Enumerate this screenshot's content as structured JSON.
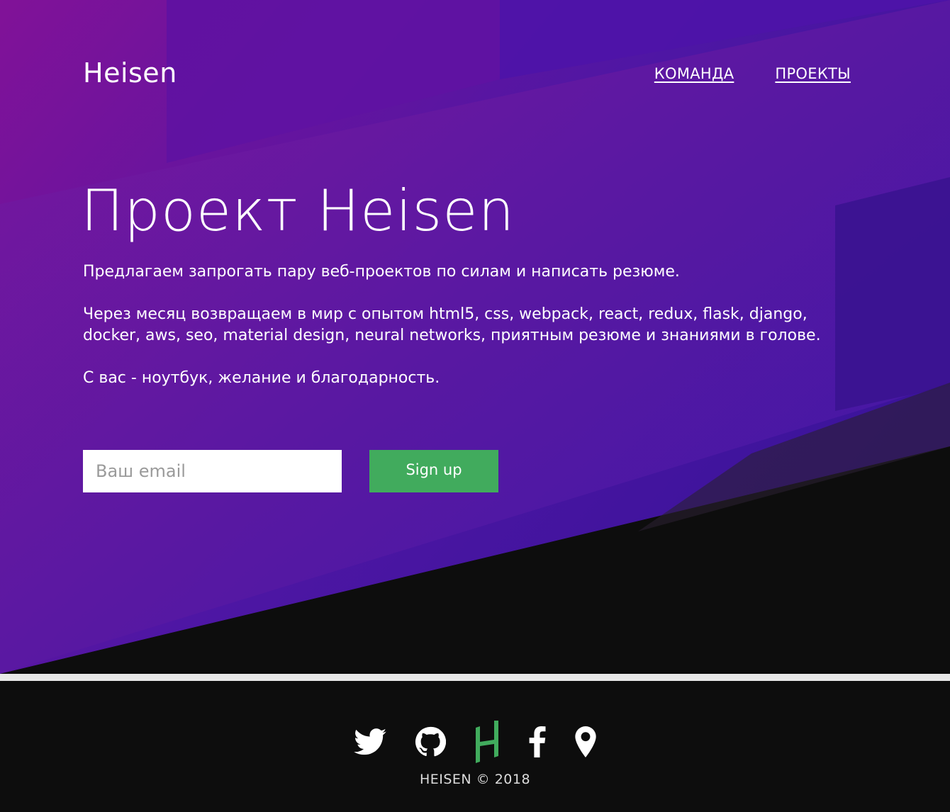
{
  "site": {
    "logo": "Heisen"
  },
  "nav": {
    "items": [
      {
        "label": "КОМАНДА"
      },
      {
        "label": "ПРОЕКТЫ"
      }
    ]
  },
  "hero": {
    "title": "Проект Heisen",
    "paragraphs": [
      "Предлагаем запрогать пару веб-проектов по силам и написать резюме.",
      "Через месяц возвращаем в мир с опытом html5, css, webpack, react, redux, flask, django, docker, aws, seo, material design, neural networks, приятным резюме и знаниями в голове.",
      "С вас - ноутбук, желание и благодарность."
    ]
  },
  "signup": {
    "email_placeholder": "Ваш email",
    "email_value": "",
    "button_label": "Sign up"
  },
  "footer": {
    "icons": [
      {
        "name": "twitter-icon"
      },
      {
        "name": "github-icon"
      },
      {
        "name": "heisen-logo-icon"
      },
      {
        "name": "facebook-icon"
      },
      {
        "name": "location-pin-icon"
      }
    ],
    "copyright": "HEISEN © 2018"
  },
  "colors": {
    "accent_green": "#41ab5d",
    "purple_start": "#7c1a9e",
    "purple_end": "#3d17a6",
    "dark": "#0d0d0d"
  }
}
